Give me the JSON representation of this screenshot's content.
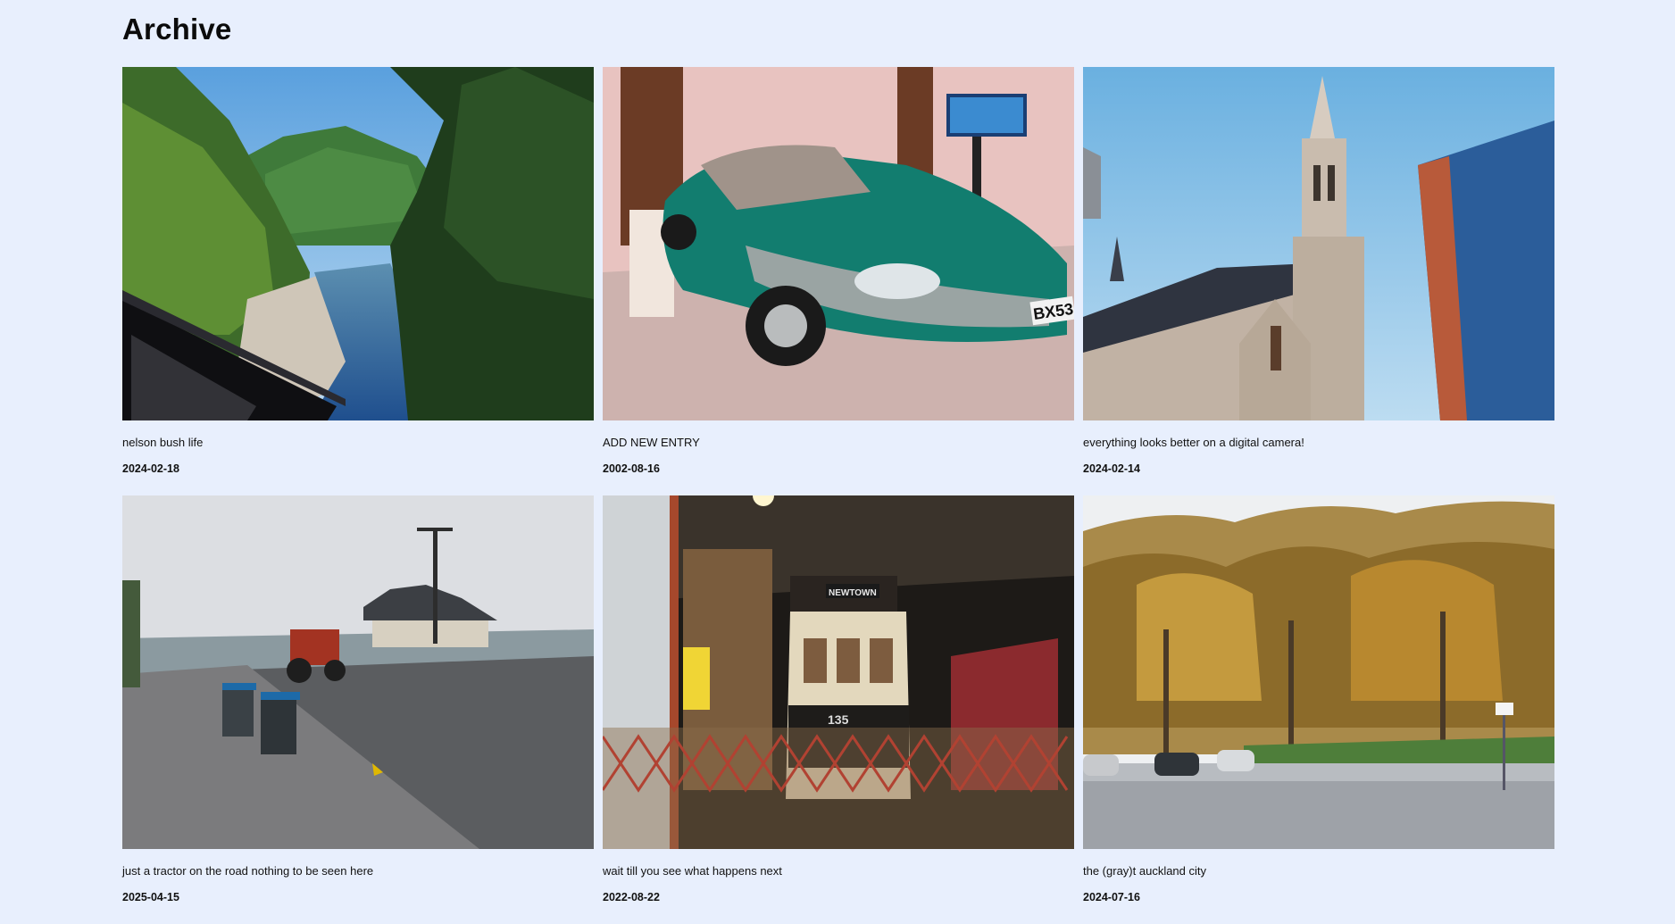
{
  "header": {
    "title": "Archive"
  },
  "entries": [
    {
      "caption": "nelson bush life",
      "date": "2024-02-18",
      "photo": "river-gorge-forest-photo"
    },
    {
      "caption": "ADD NEW ENTRY",
      "date": "2002-08-16",
      "photo": "teal-convertible-car-photo",
      "plate": "BX53"
    },
    {
      "caption": "everything looks better on a digital camera!",
      "date": "2024-02-14",
      "photo": "church-spire-skyscraper-photo"
    },
    {
      "caption": "just a tractor on the road nothing to be seen here",
      "date": "2025-04-15",
      "photo": "street-tractor-wheelie-bins-photo"
    },
    {
      "caption": "wait till you see what happens next",
      "date": "2022-08-22",
      "photo": "tram-depot-photo",
      "sign": "NEWTOWN",
      "tram_number": "135"
    },
    {
      "caption": "the (gray)t auckland city",
      "date": "2024-07-16",
      "photo": "autumn-trees-park-street-photo"
    }
  ],
  "colors": {
    "background": "#e8effd",
    "text": "#111111"
  }
}
